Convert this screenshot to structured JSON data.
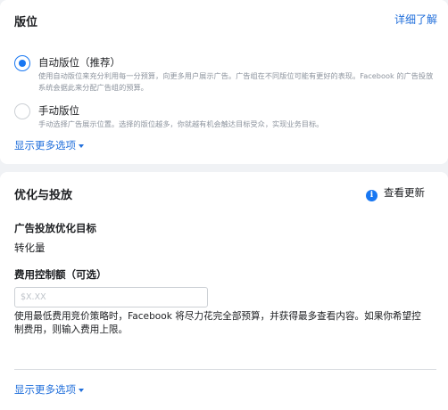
{
  "placement": {
    "title": "版位",
    "learn_more": "详细了解",
    "options": [
      {
        "label": "自动版位（推荐）",
        "selected": true,
        "description": "使用自动版位来充分利用每一分预算，向更多用户展示广告。广告组在不同版位可能有更好的表现。Facebook 的广告投放系统会据此来分配广告组的预算。"
      },
      {
        "label": "手动版位",
        "selected": false,
        "description": "手动选择广告展示位置。选择的版位越多，你就越有机会触达目标受众，实现业务目标。"
      }
    ],
    "more_options": "显示更多选项"
  },
  "optimization": {
    "title": "优化与投放",
    "whats_new": "查看更新",
    "goal_label": "广告投放优化目标",
    "goal_value": "转化量",
    "bid_label": "费用控制额（可选）",
    "bid_placeholder": "$X.XX",
    "bid_value": "",
    "help_text": "使用最低费用竞价策略时，Facebook 将尽力花完全部预算，并获得最多查看内容。如果你希望控制费用，则输入费用上限。",
    "more_options": "显示更多选项"
  },
  "colors": {
    "accent": "#1877f2",
    "link": "#216fdb",
    "background": "#f0f2f5"
  }
}
